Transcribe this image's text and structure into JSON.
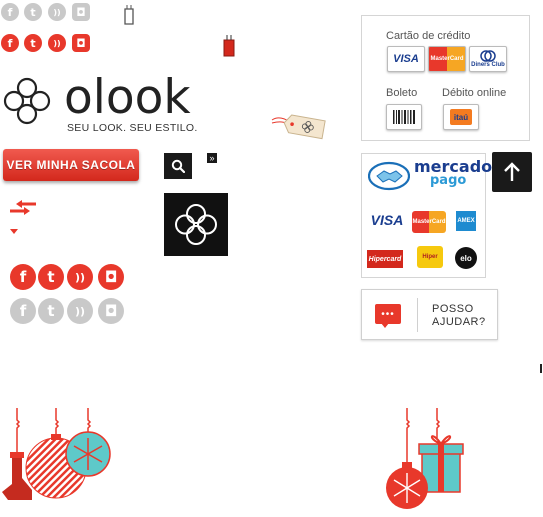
{
  "brand": {
    "name": "olook",
    "tagline": "SEU LOOK. SEU ESTILO.",
    "accent": "#e8382b"
  },
  "social": {
    "small_gray": [
      "facebook-icon",
      "twitter-icon",
      "rss-icon",
      "instagram-icon"
    ],
    "small_red": [
      "facebook-icon",
      "twitter-icon",
      "rss-icon",
      "instagram-icon"
    ],
    "large_red": [
      "facebook-icon",
      "twitter-icon",
      "rss-icon",
      "instagram-icon"
    ],
    "large_gray": [
      "facebook-icon",
      "twitter-icon",
      "rss-icon",
      "instagram-icon"
    ],
    "glyphs": {
      "facebook": "f",
      "twitter": "t",
      "rss": "))",
      "instagram": "◘"
    }
  },
  "cart": {
    "button_label": "VER MINHA SACOLA"
  },
  "search": {
    "icon": "search-icon",
    "chevron": "»"
  },
  "payment": {
    "credit_label": "Cartão de crédito",
    "credit_cards": [
      "VISA",
      "MasterCard",
      "Diners Club"
    ],
    "boleto_label": "Boleto",
    "debit_label": "Débito online",
    "debit_bank": "itaú"
  },
  "mercadopago": {
    "title_line1": "mercado",
    "title_line2": "pago",
    "cards_row1": [
      "VISA",
      "MasterCard",
      "AMEX"
    ],
    "cards_row2": [
      "Hipercard",
      "Hiper",
      "elo"
    ]
  },
  "chat": {
    "line1": "POSSO",
    "line2": "AJUDAR?"
  },
  "colors": {
    "red": "#e8382b",
    "gray": "#c9c9c9",
    "teal": "#5ec9c9",
    "dark": "#1a1a1a"
  }
}
